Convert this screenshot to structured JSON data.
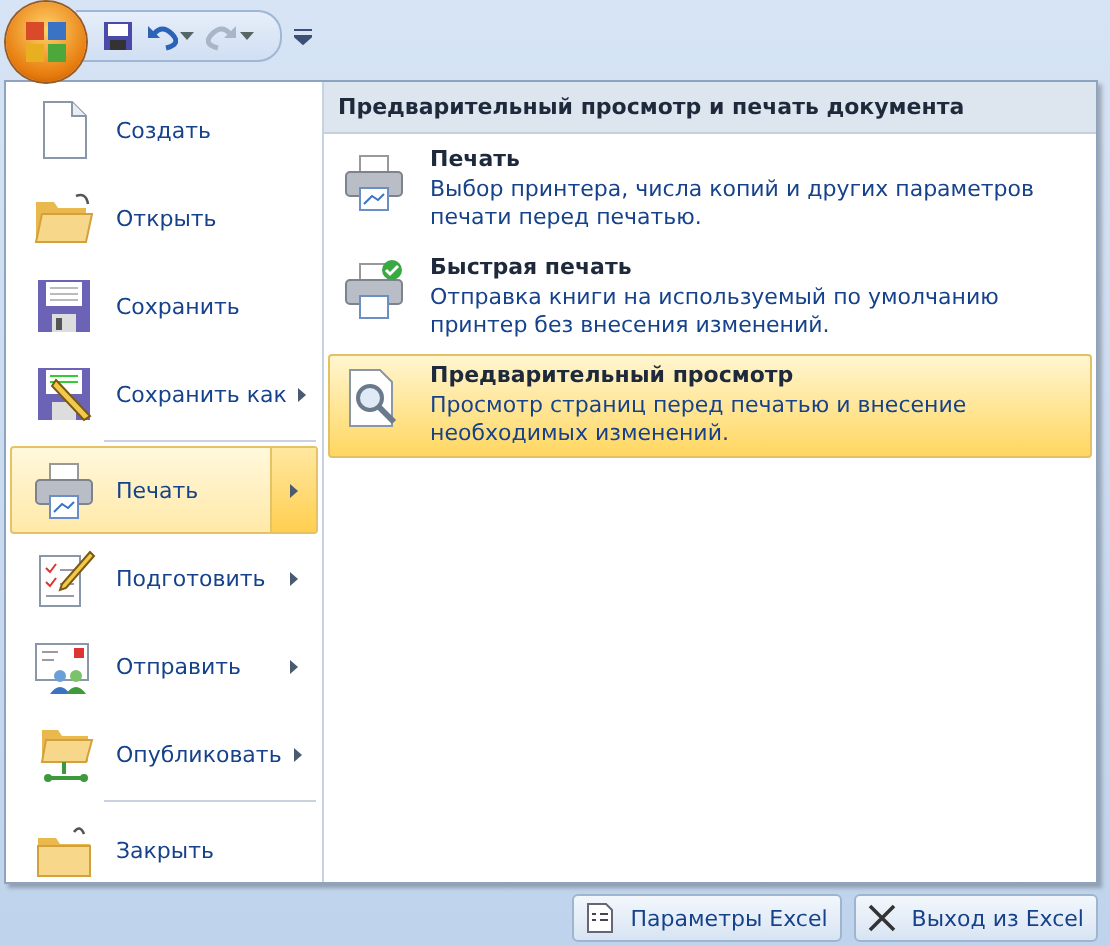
{
  "quick_access": [
    {
      "kind": "save",
      "disabled": false
    },
    {
      "kind": "undo",
      "disabled": false
    },
    {
      "kind": "redo",
      "disabled": true
    }
  ],
  "menu": {
    "items": [
      {
        "label": "Создать",
        "has_submenu": false,
        "selected": false,
        "divider_after": false
      },
      {
        "label": "Открыть",
        "has_submenu": false,
        "selected": false,
        "divider_after": false
      },
      {
        "label": "Сохранить",
        "has_submenu": false,
        "selected": false,
        "divider_after": false
      },
      {
        "label": "Сохранить как",
        "has_submenu": true,
        "selected": false,
        "divider_after": true
      },
      {
        "label": "Печать",
        "has_submenu": true,
        "selected": true,
        "divider_after": false
      },
      {
        "label": "Подготовить",
        "has_submenu": true,
        "selected": false,
        "divider_after": false
      },
      {
        "label": "Отправить",
        "has_submenu": true,
        "selected": false,
        "divider_after": false
      },
      {
        "label": "Опубликовать",
        "has_submenu": true,
        "selected": false,
        "divider_after": true
      },
      {
        "label": "Закрыть",
        "has_submenu": false,
        "selected": false,
        "divider_after": false
      }
    ]
  },
  "submenu": {
    "title": "Предварительный просмотр и печать документа",
    "options": [
      {
        "kind": "print",
        "title": "Печать",
        "description": "Выбор принтера, числа копий и других параметров печати перед печатью.",
        "selected": false
      },
      {
        "kind": "quick_print",
        "title": "Быстрая печать",
        "description": "Отправка книги на используемый по умолчанию принтер без внесения изменений.",
        "selected": false
      },
      {
        "kind": "preview",
        "title": "Предварительный просмотр",
        "description": "Просмотр страниц перед печатью и внесение необходимых изменений.",
        "selected": true
      }
    ]
  },
  "footer_buttons": [
    {
      "kind": "options",
      "label": "Параметры Excel"
    },
    {
      "kind": "exit",
      "label": "Выход из Excel"
    }
  ]
}
